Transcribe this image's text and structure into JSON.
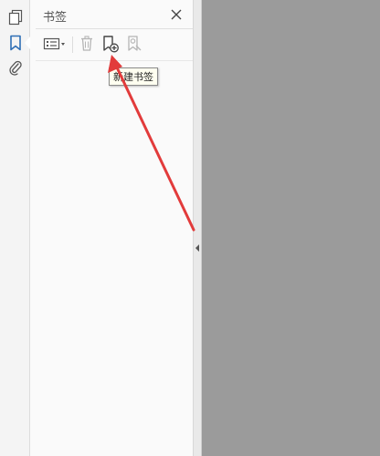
{
  "sidebar": {
    "items": [
      {
        "name": "pages",
        "icon": "pages-icon"
      },
      {
        "name": "bookmarks",
        "icon": "bookmark-icon",
        "active": true
      },
      {
        "name": "attachments",
        "icon": "paperclip-icon"
      }
    ]
  },
  "panel": {
    "title": "书签",
    "toolbar": {
      "options_icon": "bookmark-options-icon",
      "delete_icon": "trash-icon",
      "new_icon": "new-bookmark-icon",
      "goto_icon": "bookmark-goto-icon"
    },
    "tooltip": "新建书签"
  },
  "colors": {
    "accent": "#2f6fb5",
    "annotation_arrow": "#e23b3b",
    "document_bg": "#9b9b9b"
  }
}
